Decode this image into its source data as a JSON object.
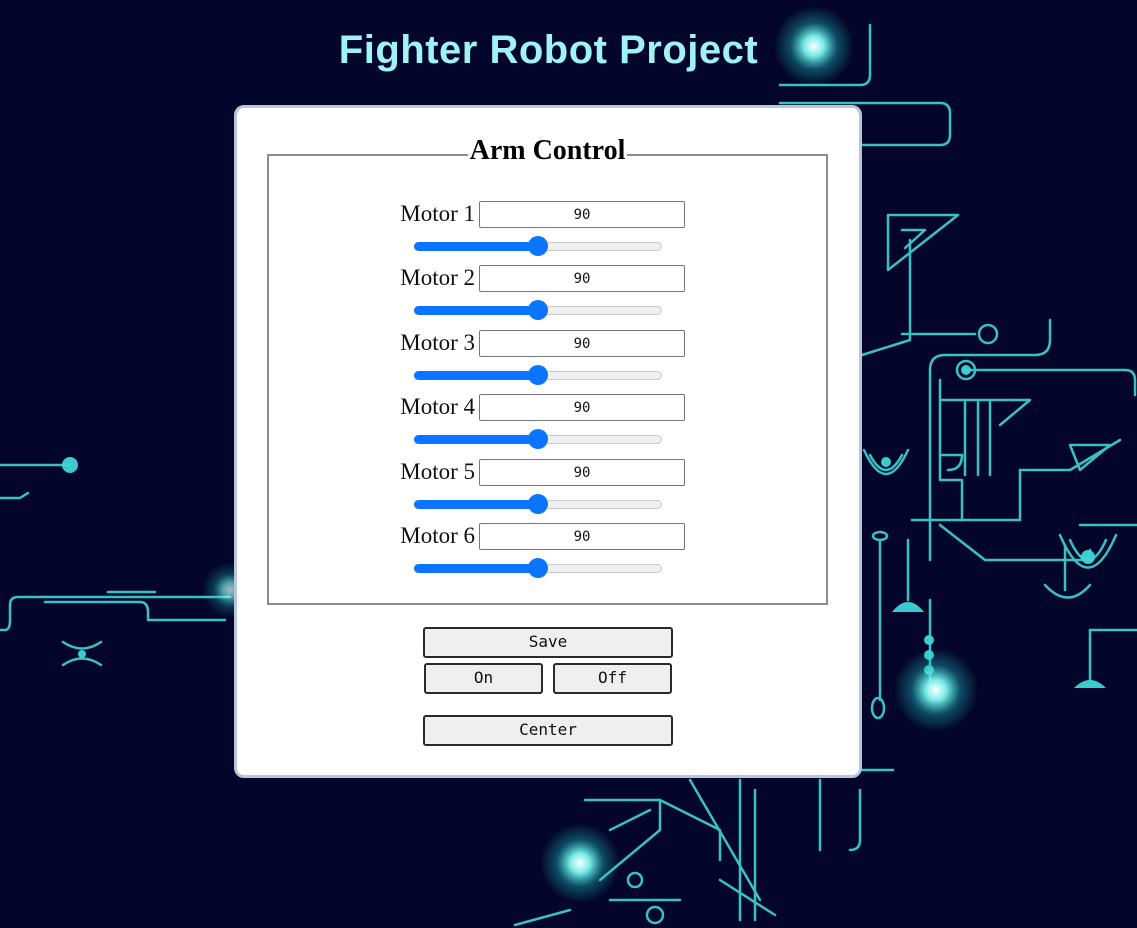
{
  "header": {
    "title": "Fighter Robot Project"
  },
  "arm_control": {
    "legend": "Arm Control",
    "motors": [
      {
        "label": "Motor 1",
        "value": "90",
        "slider_fraction": 0.5
      },
      {
        "label": "Motor 2",
        "value": "90",
        "slider_fraction": 0.5
      },
      {
        "label": "Motor 3",
        "value": "90",
        "slider_fraction": 0.5
      },
      {
        "label": "Motor 4",
        "value": "90",
        "slider_fraction": 0.5
      },
      {
        "label": "Motor 5",
        "value": "90",
        "slider_fraction": 0.5
      },
      {
        "label": "Motor 6",
        "value": "90",
        "slider_fraction": 0.5
      }
    ]
  },
  "buttons": {
    "save": "Save",
    "on": "On",
    "off": "Off",
    "center": "Center"
  },
  "colors": {
    "background": "#03052a",
    "circuit": "#3fd6d6",
    "title": "#9ff2f7",
    "slider_accent": "#0b75ff"
  }
}
